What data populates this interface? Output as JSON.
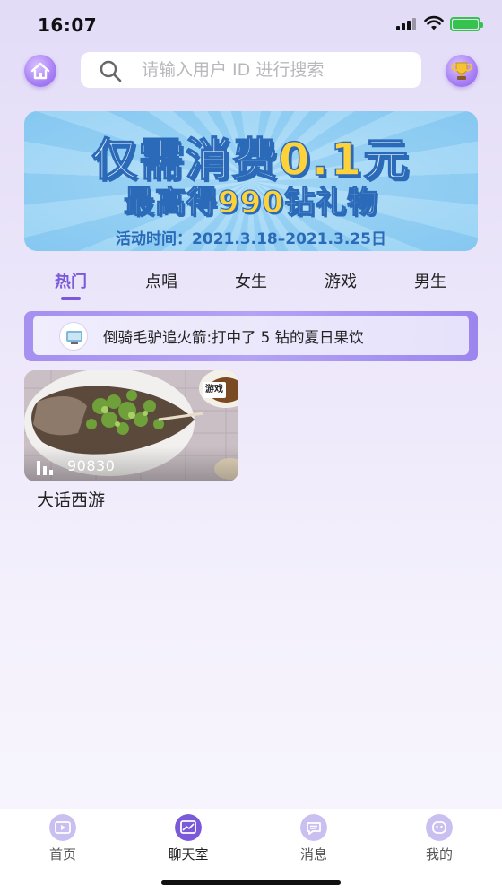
{
  "status_bar": {
    "time": "16:07"
  },
  "search": {
    "placeholder": "请输入用户 ID 进行搜索"
  },
  "banner": {
    "line1_a": "仅需消费",
    "line1_b": "0.1",
    "line1_c": "元",
    "line2_a": "最高得",
    "line2_b": "990",
    "line2_c": "钻礼物",
    "period": "活动时间：2021.3.18–2021.3.25日"
  },
  "tabs": [
    "热门",
    "点唱",
    "女生",
    "游戏",
    "男生"
  ],
  "notice": {
    "text": "倒骑毛驴追火箭:打中了 5 钻的夏日果饮"
  },
  "rooms": [
    {
      "tag": "游戏",
      "count": "90830",
      "title": "大话西游"
    }
  ],
  "tabbar": [
    "首页",
    "聊天室",
    "消息",
    "我的"
  ],
  "colors": {
    "accent": "#7a5ad8",
    "battery": "#35c24d",
    "notice_bar": "#a690f0"
  }
}
